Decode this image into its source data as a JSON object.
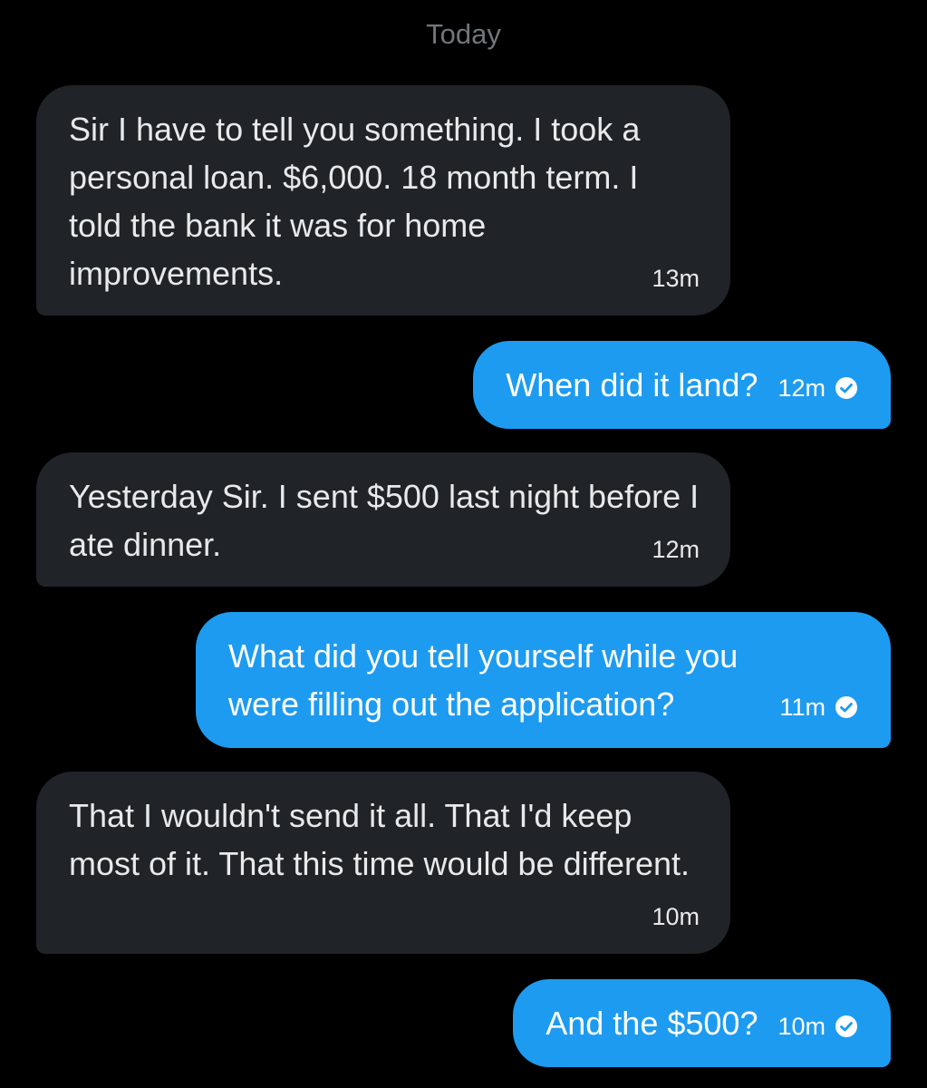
{
  "date_separator": "Today",
  "messages": [
    {
      "direction": "incoming",
      "text": "Sir I have to tell you something. I took a personal loan. $6,000. 18 month term. I told the bank it was for home improvements.",
      "time": "13m"
    },
    {
      "direction": "outgoing",
      "text": "When did it land?",
      "time": "12m",
      "status_icon": "check-circle-icon"
    },
    {
      "direction": "incoming",
      "text": "Yesterday Sir. I sent $500 last night before I ate dinner.",
      "time": "12m"
    },
    {
      "direction": "outgoing",
      "text": "What did you tell yourself while you were filling out the application?",
      "time": "11m",
      "status_icon": "check-circle-icon"
    },
    {
      "direction": "incoming",
      "text": "That I wouldn't send it all. That I'd keep most of it. That this time would be different.",
      "time": "10m"
    },
    {
      "direction": "outgoing",
      "text": "And the $500?",
      "time": "10m",
      "status_icon": "check-circle-icon"
    }
  ],
  "colors": {
    "background": "#000000",
    "incoming_bubble": "#202327",
    "outgoing_bubble": "#1d9bf0",
    "text": "#e7e9ea",
    "muted": "#71767b"
  }
}
